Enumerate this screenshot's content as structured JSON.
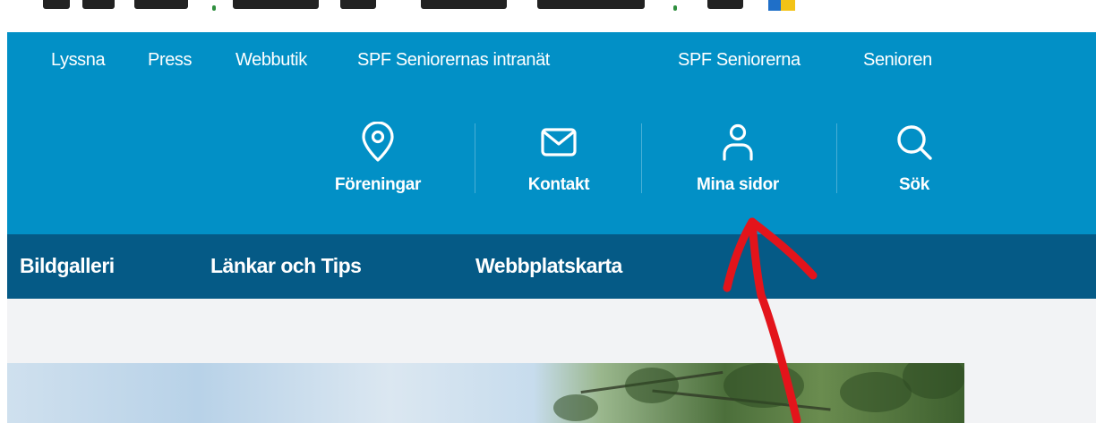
{
  "top_links": [
    "Lyssna",
    "Press",
    "Webbutik",
    "SPF Seniorernas intranät",
    "SPF Seniorerna",
    "Senioren"
  ],
  "icon_nav": {
    "foreningar": {
      "label": "Föreningar",
      "icon": "location-pin-icon"
    },
    "kontakt": {
      "label": "Kontakt",
      "icon": "envelope-icon"
    },
    "mina_sidor": {
      "label": "Mina sidor",
      "icon": "user-icon"
    },
    "sok": {
      "label": "Sök",
      "icon": "search-icon"
    }
  },
  "main_nav": [
    "Bildgalleri",
    "Länkar och Tips",
    "Webbplatskarta"
  ],
  "colors": {
    "header_blue": "#0290c6",
    "nav_dark_blue": "#055a86",
    "annotation_red": "#e3141b"
  }
}
